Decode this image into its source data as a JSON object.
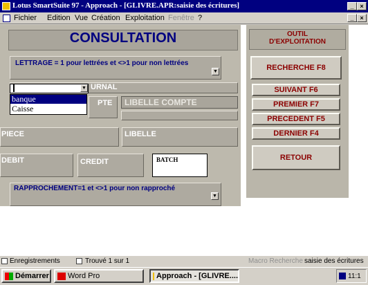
{
  "window": {
    "title": "Lotus SmartSuite 97  -  Approach - [GLIVRE.APR:saisie des écritures]",
    "min_glyph": "_",
    "close_glyph": "×"
  },
  "menu": {
    "items": [
      "Fichier",
      "Edition",
      "Vue",
      "Création",
      "Exploitation",
      "Fenêtre",
      "?"
    ],
    "disabled_index": 5
  },
  "form": {
    "title": "CONSULTATION",
    "tool_panel_title": "OUTIL\nD'EXPLOITATION",
    "lettrage_label": "LETTRAGE = 1  pour lettrées  et  <>1 pour non lettrées",
    "journal_label": "URNAL",
    "journal_value": "",
    "journal_options": [
      "banque",
      "Caisse"
    ],
    "journal_selected_index": 0,
    "compte_label": "PTE",
    "libelle_compte_label": "LIBELLE COMPTE",
    "piece_label": "PIECE",
    "libelle_label": "LIBELLE",
    "debit_label": "DEBIT",
    "credit_label": "CREDIT",
    "batch_label": "BATCH",
    "rapprochement_label": "RAPPROCHEMENT=1 et <>1 pour non rapproché"
  },
  "buttons": {
    "recherche": "RECHERCHE F8",
    "suivant": "SUIVANT F6",
    "premier": "PREMIER F7",
    "precedent": "PRECEDENT F5",
    "dernier": "DERNIER F4",
    "retour": "RETOUR"
  },
  "status": {
    "mode": "Enregistrements",
    "found": "Trouvé 1 sur 1",
    "macro": "Macro Recherche",
    "view": "saisie des écritures"
  },
  "taskbar": {
    "start": "Démarrer",
    "wordpro": "Word Pro",
    "approach": "Approach - [GLIVRE....",
    "clock": "11:1"
  },
  "colors": {
    "title_bar": "#000080",
    "form_title": "#000080",
    "button_text": "#8b0000",
    "field_bg": "#aeaaa0",
    "selection": "#000080"
  }
}
